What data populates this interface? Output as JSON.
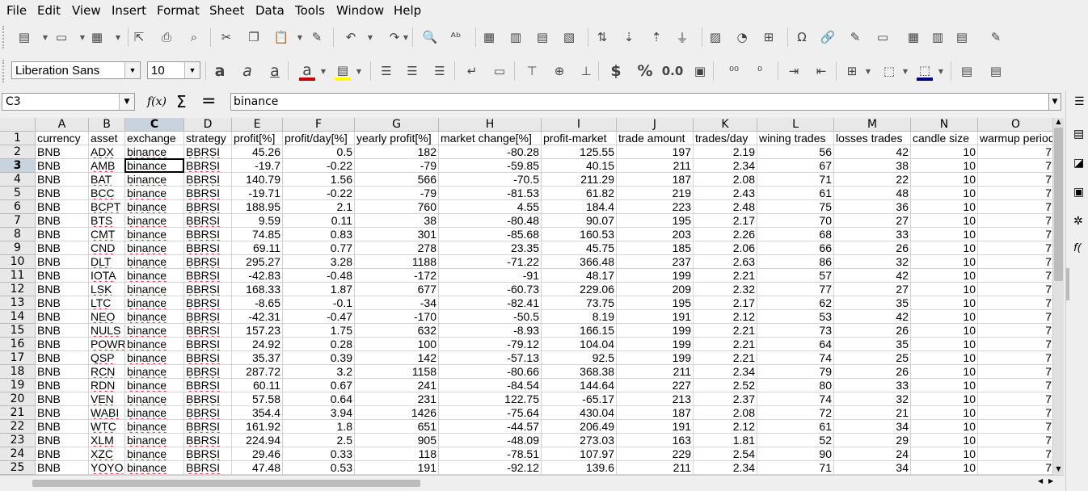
{
  "menu": [
    "File",
    "Edit",
    "View",
    "Insert",
    "Format",
    "Sheet",
    "Data",
    "Tools",
    "Window",
    "Help"
  ],
  "font": {
    "name": "Liberation Sans",
    "size": "10"
  },
  "namebox": "C3",
  "formula": {
    "fx": "f(x)",
    "sum": "Σ",
    "eq": "=",
    "content": "binance"
  },
  "toolbar_icons_1": [
    "new-document-icon",
    "open-folder-icon",
    "templates-icon",
    "export-pdf-icon",
    "print-icon",
    "print-preview-icon",
    "cut-icon",
    "copy-icon",
    "paste-icon",
    "clone-format-icon",
    "undo-icon",
    "redo-icon",
    "find-replace-icon",
    "spelling-icon",
    "row-icon",
    "column-icon",
    "insert-rows-icon",
    "delete-rows-icon",
    "sort-icon",
    "sort-ascending-icon",
    "sort-descending-icon",
    "autofilter-icon",
    "insert-image-icon",
    "insert-chart-icon",
    "pivot-table-icon",
    "special-character-icon",
    "hyperlink-icon",
    "comment-icon",
    "headers-footers-icon",
    "define-print-area-icon",
    "freeze-rows-icon",
    "split-window-icon",
    "show-draw-functions-icon"
  ],
  "toolbar_icons_2": [
    "bold-icon",
    "italic-icon",
    "underline-icon",
    "font-color-icon",
    "highlight-color-icon",
    "align-left-icon",
    "align-center-icon",
    "align-right-icon",
    "wrap-text-icon",
    "merge-cells-icon",
    "align-top-icon",
    "align-middle-icon",
    "align-bottom-icon",
    "currency-format-icon",
    "percent-format-icon",
    "decimal-format-icon",
    "date-format-icon",
    "add-decimal-icon",
    "delete-decimal-icon",
    "increase-indent-icon",
    "decrease-indent-icon",
    "borders-icon",
    "border-style-icon",
    "border-color-icon",
    "conditional-format-icon",
    "styles-icon"
  ],
  "toolbar_glyphs": {
    "bold": "a",
    "italic": "a",
    "underline": "a",
    "currency": "$",
    "percent": "%",
    "decimal": "0.0"
  },
  "columns": [
    {
      "id": "A",
      "label": "A"
    },
    {
      "id": "B",
      "label": "B"
    },
    {
      "id": "C",
      "label": "C"
    },
    {
      "id": "D",
      "label": "D"
    },
    {
      "id": "E",
      "label": "E"
    },
    {
      "id": "F",
      "label": "F"
    },
    {
      "id": "G",
      "label": "G"
    },
    {
      "id": "H",
      "label": "H"
    },
    {
      "id": "I",
      "label": "I"
    },
    {
      "id": "J",
      "label": "J"
    },
    {
      "id": "K",
      "label": "K"
    },
    {
      "id": "L",
      "label": "L"
    },
    {
      "id": "M",
      "label": "M"
    },
    {
      "id": "N",
      "label": "N"
    },
    {
      "id": "O",
      "label": "O"
    }
  ],
  "selected_column": "C",
  "selected_row": 3,
  "header_row": [
    "currency",
    "asset",
    "exchange",
    "strategy",
    "profit[%]",
    "profit/day[%]",
    "yearly profit[%]",
    "market change[%]",
    "profit-market",
    "trade amount",
    "trades/day",
    "wining trades",
    "losses trades",
    "candle size",
    "warmup period"
  ],
  "rows": [
    {
      "n": "2",
      "cells": [
        "BNB",
        "ADX",
        "binance",
        "BBRSI",
        "45.26",
        "0.5",
        "182",
        "-80.28",
        "125.55",
        "197",
        "2.19",
        "56",
        "42",
        "10",
        "7"
      ]
    },
    {
      "n": "3",
      "cells": [
        "BNB",
        "AMB",
        "binance",
        "BBRSI",
        "-19.7",
        "-0.22",
        "-79",
        "-59.85",
        "40.15",
        "211",
        "2.34",
        "67",
        "38",
        "10",
        "7"
      ]
    },
    {
      "n": "4",
      "cells": [
        "BNB",
        "BAT",
        "binance",
        "BBRSI",
        "140.79",
        "1.56",
        "566",
        "-70.5",
        "211.29",
        "187",
        "2.08",
        "71",
        "22",
        "10",
        "7"
      ]
    },
    {
      "n": "5",
      "cells": [
        "BNB",
        "BCC",
        "binance",
        "BBRSI",
        "-19.71",
        "-0.22",
        "-79",
        "-81.53",
        "61.82",
        "219",
        "2.43",
        "61",
        "48",
        "10",
        "7"
      ]
    },
    {
      "n": "6",
      "cells": [
        "BNB",
        "BCPT",
        "binance",
        "BBRSI",
        "188.95",
        "2.1",
        "760",
        "4.55",
        "184.4",
        "223",
        "2.48",
        "75",
        "36",
        "10",
        "7"
      ]
    },
    {
      "n": "7",
      "cells": [
        "BNB",
        "BTS",
        "binance",
        "BBRSI",
        "9.59",
        "0.11",
        "38",
        "-80.48",
        "90.07",
        "195",
        "2.17",
        "70",
        "27",
        "10",
        "7"
      ]
    },
    {
      "n": "8",
      "cells": [
        "BNB",
        "CMT",
        "binance",
        "BBRSI",
        "74.85",
        "0.83",
        "301",
        "-85.68",
        "160.53",
        "203",
        "2.26",
        "68",
        "33",
        "10",
        "7"
      ]
    },
    {
      "n": "9",
      "cells": [
        "BNB",
        "CND",
        "binance",
        "BBRSI",
        "69.11",
        "0.77",
        "278",
        "23.35",
        "45.75",
        "185",
        "2.06",
        "66",
        "26",
        "10",
        "7"
      ]
    },
    {
      "n": "10",
      "cells": [
        "BNB",
        "DLT",
        "binance",
        "BBRSI",
        "295.27",
        "3.28",
        "1188",
        "-71.22",
        "366.48",
        "237",
        "2.63",
        "86",
        "32",
        "10",
        "7"
      ]
    },
    {
      "n": "11",
      "cells": [
        "BNB",
        "IOTA",
        "binance",
        "BBRSI",
        "-42.83",
        "-0.48",
        "-172",
        "-91",
        "48.17",
        "199",
        "2.21",
        "57",
        "42",
        "10",
        "7"
      ]
    },
    {
      "n": "12",
      "cells": [
        "BNB",
        "LSK",
        "binance",
        "BBRSI",
        "168.33",
        "1.87",
        "677",
        "-60.73",
        "229.06",
        "209",
        "2.32",
        "77",
        "27",
        "10",
        "7"
      ]
    },
    {
      "n": "13",
      "cells": [
        "BNB",
        "LTC",
        "binance",
        "BBRSI",
        "-8.65",
        "-0.1",
        "-34",
        "-82.41",
        "73.75",
        "195",
        "2.17",
        "62",
        "35",
        "10",
        "7"
      ]
    },
    {
      "n": "14",
      "cells": [
        "BNB",
        "NEO",
        "binance",
        "BBRSI",
        "-42.31",
        "-0.47",
        "-170",
        "-50.5",
        "8.19",
        "191",
        "2.12",
        "53",
        "42",
        "10",
        "7"
      ]
    },
    {
      "n": "15",
      "cells": [
        "BNB",
        "NULS",
        "binance",
        "BBRSI",
        "157.23",
        "1.75",
        "632",
        "-8.93",
        "166.15",
        "199",
        "2.21",
        "73",
        "26",
        "10",
        "7"
      ]
    },
    {
      "n": "16",
      "cells": [
        "BNB",
        "POWR",
        "binance",
        "BBRSI",
        "24.92",
        "0.28",
        "100",
        "-79.12",
        "104.04",
        "199",
        "2.21",
        "64",
        "35",
        "10",
        "7"
      ]
    },
    {
      "n": "17",
      "cells": [
        "BNB",
        "QSP",
        "binance",
        "BBRSI",
        "35.37",
        "0.39",
        "142",
        "-57.13",
        "92.5",
        "199",
        "2.21",
        "74",
        "25",
        "10",
        "7"
      ]
    },
    {
      "n": "18",
      "cells": [
        "BNB",
        "RCN",
        "binance",
        "BBRSI",
        "287.72",
        "3.2",
        "1158",
        "-80.66",
        "368.38",
        "211",
        "2.34",
        "79",
        "26",
        "10",
        "7"
      ]
    },
    {
      "n": "19",
      "cells": [
        "BNB",
        "RDN",
        "binance",
        "BBRSI",
        "60.11",
        "0.67",
        "241",
        "-84.54",
        "144.64",
        "227",
        "2.52",
        "80",
        "33",
        "10",
        "7"
      ]
    },
    {
      "n": "20",
      "cells": [
        "BNB",
        "VEN",
        "binance",
        "BBRSI",
        "57.58",
        "0.64",
        "231",
        "122.75",
        "-65.17",
        "213",
        "2.37",
        "74",
        "32",
        "10",
        "7"
      ]
    },
    {
      "n": "21",
      "cells": [
        "BNB",
        "WABI",
        "binance",
        "BBRSI",
        "354.4",
        "3.94",
        "1426",
        "-75.64",
        "430.04",
        "187",
        "2.08",
        "72",
        "21",
        "10",
        "7"
      ]
    },
    {
      "n": "22",
      "cells": [
        "BNB",
        "WTC",
        "binance",
        "BBRSI",
        "161.92",
        "1.8",
        "651",
        "-44.57",
        "206.49",
        "191",
        "2.12",
        "61",
        "34",
        "10",
        "7"
      ]
    },
    {
      "n": "23",
      "cells": [
        "BNB",
        "XLM",
        "binance",
        "BBRSI",
        "224.94",
        "2.5",
        "905",
        "-48.09",
        "273.03",
        "163",
        "1.81",
        "52",
        "29",
        "10",
        "7"
      ]
    },
    {
      "n": "24",
      "cells": [
        "BNB",
        "XZC",
        "binance",
        "BBRSI",
        "29.46",
        "0.33",
        "118",
        "-78.51",
        "107.97",
        "229",
        "2.54",
        "90",
        "24",
        "10",
        "7"
      ]
    },
    {
      "n": "25",
      "cells": [
        "BNB",
        "YOYO",
        "binance",
        "BBRSI",
        "47.48",
        "0.53",
        "191",
        "-92.12",
        "139.6",
        "211",
        "2.34",
        "71",
        "34",
        "10",
        "7"
      ]
    }
  ]
}
